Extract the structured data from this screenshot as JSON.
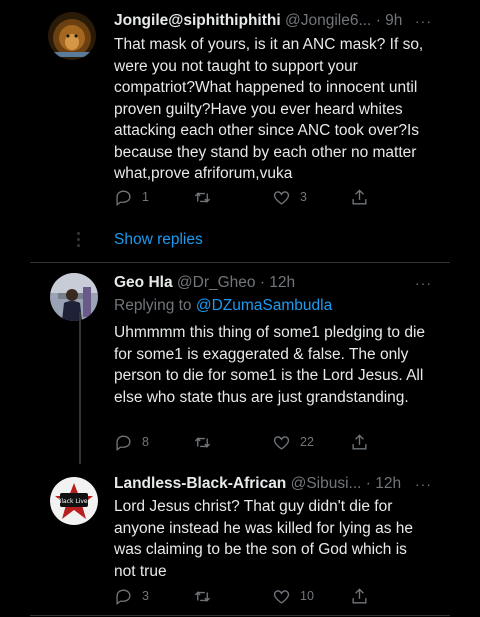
{
  "tweets": [
    {
      "name": "Jongile@siphithiphithi",
      "handle": "@Jongile6...",
      "time": "· 9h",
      "replying_label": "",
      "mention": "",
      "text": "That mask of yours, is it an ANC mask? If so, were you not taught to support your compatriot?What happened to innocent until proven guilty?Have you ever heard whites attacking each other since ANC took over?Is because they stand by each other no matter what,prove afriforum,vuka",
      "reply_count": "1",
      "retweet_count": "",
      "like_count": "3"
    },
    {
      "name": "Geo Hla",
      "handle": "@Dr_Gheo",
      "time": "· 12h",
      "replying_label": "Replying to",
      "mention": "@DZumaSambudla",
      "text": "Uhmmmm this thing of some1 pledging to die for some1 is exaggerated & false. The only person to die for some1 is the Lord Jesus. All else who state thus are just grandstanding.",
      "reply_count": "8",
      "retweet_count": "",
      "like_count": "22"
    },
    {
      "name": "Landless-Black-African",
      "handle": "@Sibusi...",
      "time": "· 12h",
      "replying_label": "",
      "mention": "",
      "text": "Lord Jesus christ?  That guy didn't die for anyone instead he was killed for lying as he was claiming to be the son of God which is not true",
      "reply_count": "3",
      "retweet_count": "",
      "like_count": "10"
    }
  ],
  "show_replies": "Show replies",
  "more_glyph": "···",
  "avatar3_text": "Black Lives",
  "colors": {
    "background": "#000000",
    "text": "#e7e9ea",
    "secondary": "#71767b",
    "accent": "#1d9bf0",
    "divider": "#2f3336"
  },
  "icons": [
    "reply-icon",
    "retweet-icon",
    "like-icon",
    "share-icon",
    "more-icon"
  ]
}
